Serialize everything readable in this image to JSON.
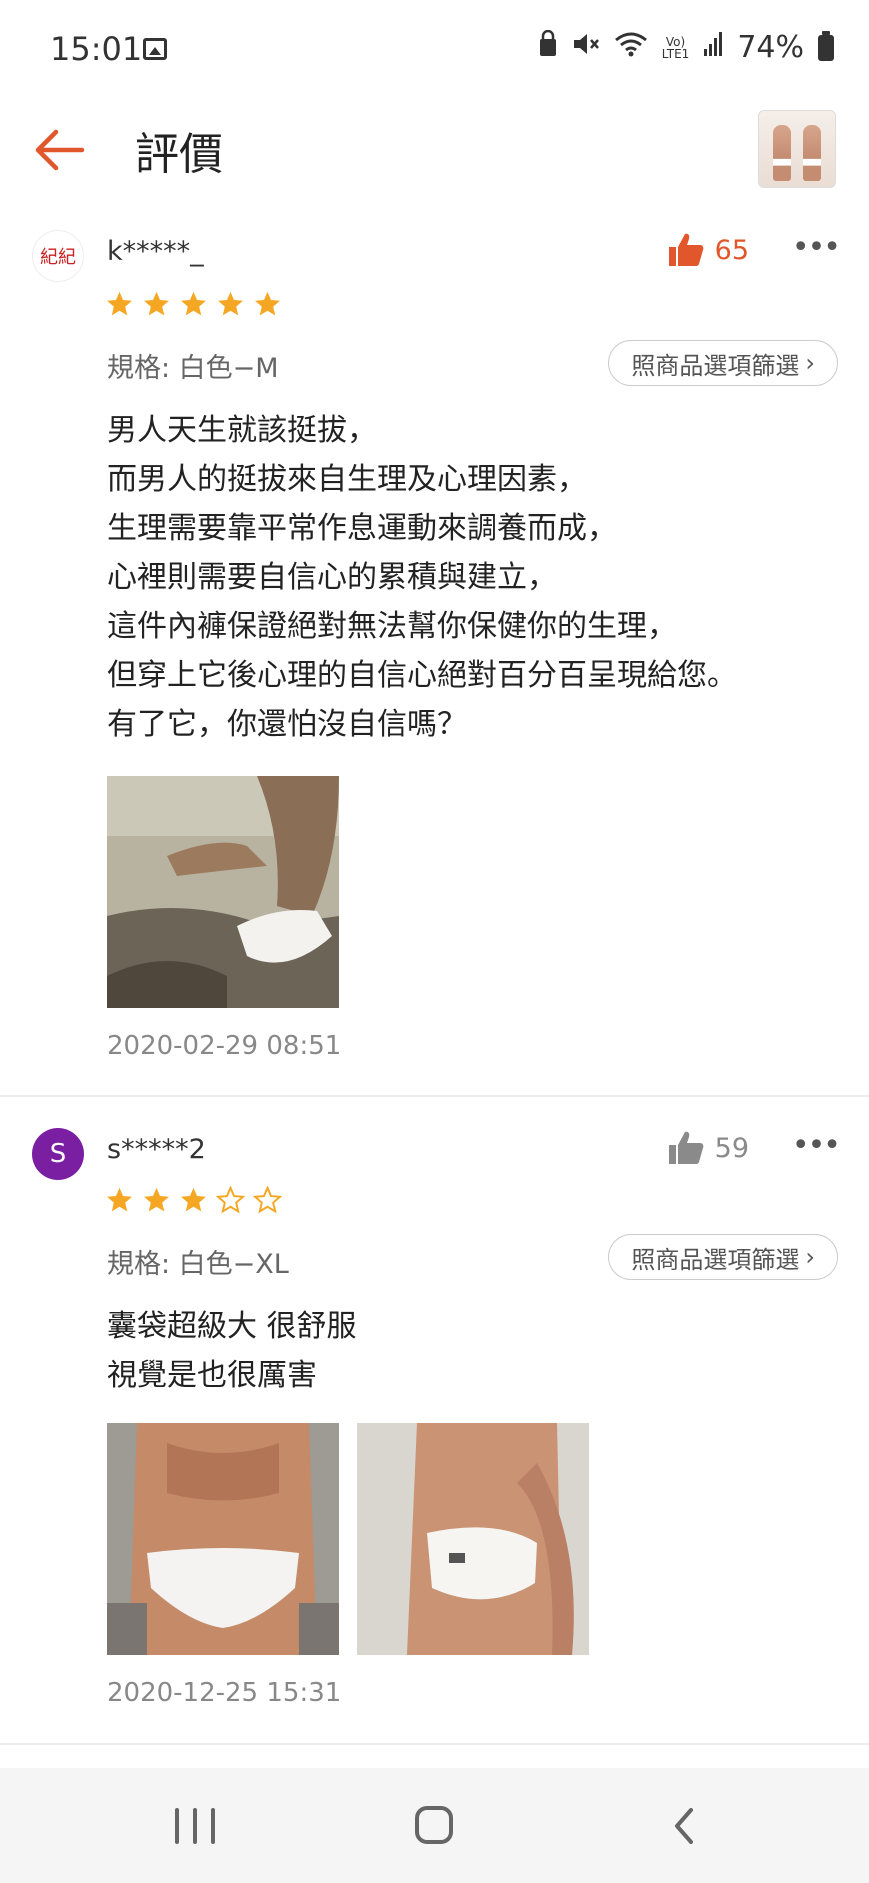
{
  "status_bar": {
    "time": "15:01",
    "battery": "74%",
    "icons": [
      "image-icon",
      "lock-icon",
      "mute-icon",
      "wifi-icon",
      "volte-icon",
      "signal-icon",
      "battery-icon"
    ]
  },
  "header": {
    "title": "評價",
    "back_icon": "arrow-left-icon",
    "accent_color": "#e2562b"
  },
  "reviews": [
    {
      "username": "k*****_",
      "avatar_text": "紀紀",
      "likes": "65",
      "liked": true,
      "rating": 5,
      "spec": "規格: 白色−M",
      "filter_label": "照商品選項篩選",
      "content": "男人天生就該挺拔，\n而男人的挺拔來自生理及心理因素，\n生理需要靠平常作息運動來調養而成，\n心裡則需要自信心的累積與建立，\n這件內褲保證絕對無法幫你保健你的生理，\n但穿上它後心理的自信心絕對百分百呈現給您。\n有了它，你還怕沒自信嗎？",
      "photo_count": 1,
      "date": "2020-02-29 08:51"
    },
    {
      "username": "s*****2",
      "avatar_text": "S",
      "likes": "59",
      "liked": false,
      "rating": 3,
      "spec": "規格: 白色−XL",
      "filter_label": "照商品選項篩選",
      "content": "囊袋超級大 很舒服\n視覺是也很厲害",
      "photo_count": 2,
      "date": "2020-12-25 15:31"
    }
  ],
  "colors": {
    "star": "#f5a623",
    "like_active": "#e2562b",
    "like_inactive": "#8a8a8a"
  }
}
